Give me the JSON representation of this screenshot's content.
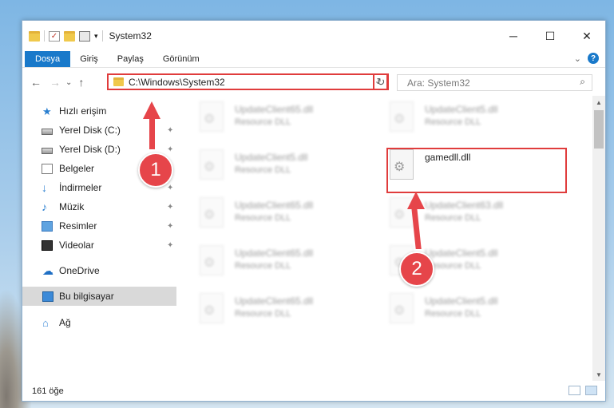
{
  "window": {
    "title": "System32",
    "minimize": "─",
    "maximize": "☐",
    "close": "✕"
  },
  "ribbon": {
    "tabs": [
      "Dosya",
      "Giriş",
      "Paylaş",
      "Görünüm"
    ],
    "expand": "⌄",
    "help": "?"
  },
  "nav": {
    "back": "←",
    "forward": "→",
    "recent": "⌄",
    "up": "↑",
    "address": "C:\\Windows\\System32",
    "address_dropdown": "⌄",
    "refresh": "↻",
    "search_placeholder": "Ara: System32",
    "search_icon": "⌕"
  },
  "sidebar": {
    "items": [
      {
        "label": "Hızlı erişim",
        "icon": "star-icon"
      },
      {
        "label": "Yerel Disk (C:)",
        "icon": "drive-icon"
      },
      {
        "label": "Yerel Disk (D:)",
        "icon": "drive-icon"
      },
      {
        "label": "Belgeler",
        "icon": "documents-icon"
      },
      {
        "label": "İndirmeler",
        "icon": "downloads-icon"
      },
      {
        "label": "Müzik",
        "icon": "music-icon"
      },
      {
        "label": "Resimler",
        "icon": "pictures-icon"
      },
      {
        "label": "Videolar",
        "icon": "videos-icon"
      },
      {
        "label": "OneDrive",
        "icon": "onedrive-icon"
      },
      {
        "label": "Bu bilgisayar",
        "icon": "this-pc-icon"
      },
      {
        "label": "Ağ",
        "icon": "network-icon"
      }
    ],
    "pin_glyph": "📌"
  },
  "files": [
    {
      "name": "UpdateClient65.dll",
      "type": "Resource DLL"
    },
    {
      "name": "UpdateClient5.dll",
      "type": "Resource DLL"
    },
    {
      "name": "UpdateClient5.dll",
      "type": "Resource DLL"
    },
    {
      "name": "gamedll.dll",
      "type": ""
    },
    {
      "name": "UpdateClient65.dll",
      "type": "Resource DLL"
    },
    {
      "name": "UpdateClient63.dll",
      "type": "Resource DLL"
    },
    {
      "name": "UpdateClient65.dll",
      "type": "Resource DLL"
    },
    {
      "name": "UpdateClient5.dll",
      "type": "Resource DLL"
    },
    {
      "name": "UpdateClient65.dll",
      "type": "Resource DLL"
    },
    {
      "name": "UpdateClient5.dll",
      "type": "Resource DLL"
    }
  ],
  "status": {
    "item_count": "161 öğe"
  },
  "annotations": {
    "step1": "1",
    "step2": "2"
  },
  "colors": {
    "accent": "#1979ca",
    "highlight_red": "#e03c3c",
    "annotation_red": "#e6454a"
  }
}
